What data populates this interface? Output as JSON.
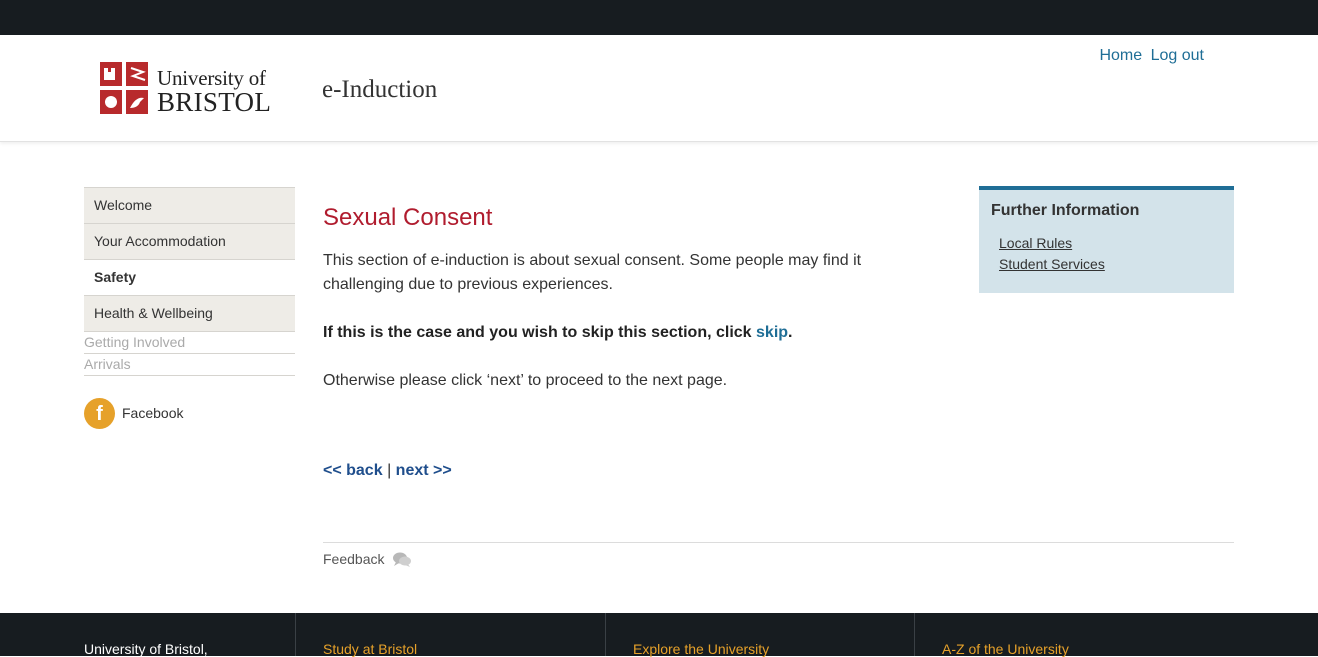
{
  "header": {
    "logo": {
      "line1": "University of",
      "line2": "BRISTOL"
    },
    "site_title": "e-Induction",
    "links": [
      {
        "label": "Home"
      },
      {
        "label": "Log out"
      }
    ]
  },
  "sidebar": {
    "items": [
      {
        "label": "Welcome"
      },
      {
        "label": "Your Accommodation"
      },
      {
        "label": "Safety"
      },
      {
        "label": "Health & Wellbeing"
      }
    ],
    "sub_items": [
      {
        "label": "Getting Involved"
      },
      {
        "label": "Arrivals"
      }
    ],
    "social": {
      "label": "Facebook",
      "icon": "facebook-icon",
      "color": "#e6a12a"
    }
  },
  "main": {
    "heading": "Sexual Consent",
    "paragraph1": "This section of e-induction is about sexual consent.  Some people may find it challenging due to previous experiences.",
    "paragraph2_text": "If this is the case and you wish to skip this section, click ",
    "paragraph2_link": "skip",
    "paragraph2_end": ".",
    "paragraph3": "Otherwise please click ‘next’ to proceed to the next page.",
    "pager": {
      "back": "<< back",
      "separator": "|",
      "next": "next >>"
    },
    "feedback": "Feedback"
  },
  "further_info": {
    "title": "Further Information",
    "links": [
      {
        "label": "Local Rules"
      },
      {
        "label": "Student Services"
      }
    ]
  },
  "footer": {
    "columns": [
      {
        "label": "University of Bristol,"
      },
      {
        "label": "Study at Bristol"
      },
      {
        "label": "Explore the University"
      },
      {
        "label": "A-Z of the University"
      }
    ]
  },
  "colors": {
    "heading_red": "#b01c2e",
    "link_blue": "#1f6e96",
    "footer_bg": "#171c20",
    "footer_gold": "#e6a12a",
    "info_bg": "#d3e3ea"
  }
}
